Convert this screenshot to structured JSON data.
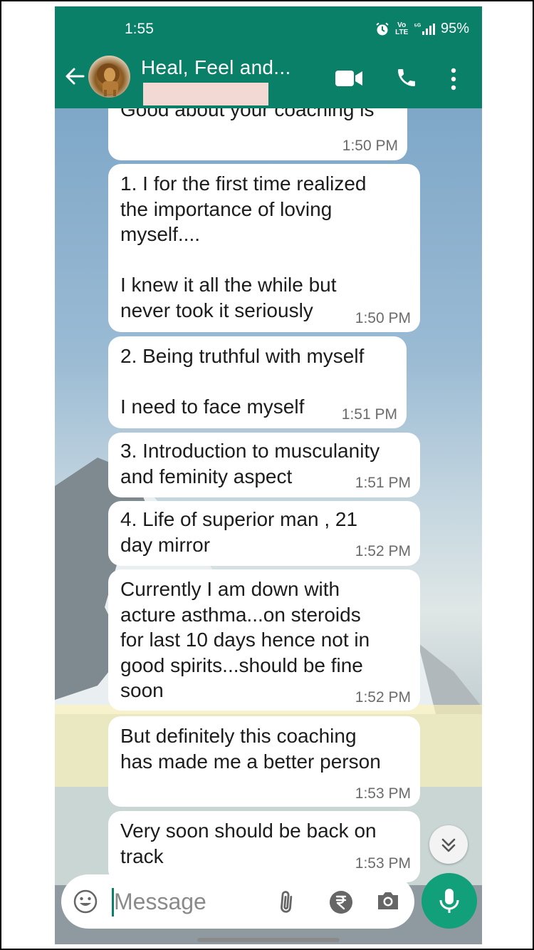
{
  "status_bar": {
    "time": "1:55",
    "network_top": "Vo",
    "network_bottom": "LTE",
    "signal": "⁵ᴳ",
    "battery": "95%"
  },
  "header": {
    "chat_title": "Heal, Feel and..."
  },
  "messages": [
    {
      "text": "Good about your coaching is",
      "time": "1:50 PM"
    },
    {
      "text": "1. I for the first time realized\nthe importance of loving\nmyself....\n\nI knew it all the while but\nnever took it seriously",
      "time": "1:50 PM"
    },
    {
      "text": "2.  Being truthful with myself\n\nI need to face myself",
      "time": "1:51 PM"
    },
    {
      "text": "3. Introduction to musculanity\nand feminity aspect",
      "time": "1:51 PM"
    },
    {
      "text": "4. Life of superior man , 21\nday mirror",
      "time": "1:52 PM"
    },
    {
      "text": "Currently I am down with\nacture asthma...on steroids\nfor last 10 days hence not in\ngood spirits...should be fine\nsoon",
      "time": "1:52 PM"
    },
    {
      "text": "But definitely this coaching\nhas made me a better person",
      "time": "1:53 PM"
    },
    {
      "text": "Very soon should be back on\ntrack",
      "time": "1:53 PM"
    }
  ],
  "composer": {
    "placeholder": "Message"
  },
  "colors": {
    "header": "#0a8068",
    "accent": "#11a07a",
    "bubble": "#ffffff",
    "highlight": "#fff3b4"
  },
  "icons": [
    "back-arrow-icon",
    "video-call-icon",
    "phone-icon",
    "more-vert-icon",
    "emoji-icon",
    "attach-icon",
    "rupee-icon",
    "camera-icon",
    "mic-icon",
    "scroll-down-icon",
    "alarm-icon"
  ]
}
